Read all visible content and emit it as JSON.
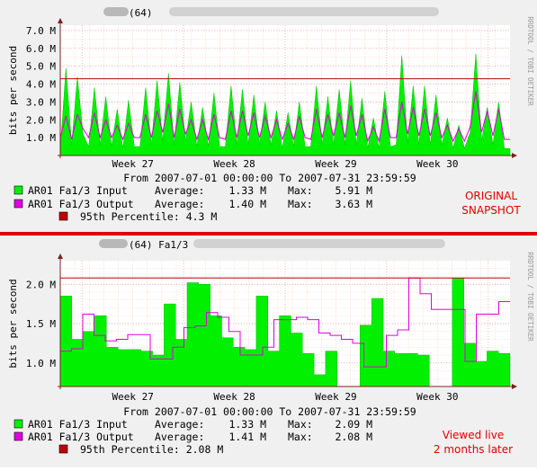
{
  "colors": {
    "input": "#00f000",
    "input_edge": "#00c000",
    "output": "#e000e0",
    "percentile": "#c00000",
    "note": "#e00000",
    "divider": "#e00000"
  },
  "chart_data": [
    {
      "type": "area",
      "title": "(64)",
      "ylabel": "bits per second",
      "ylim": [
        0,
        7.3
      ],
      "y_unit": "M",
      "y_ticks": [
        "1.0 M",
        "2.0 M",
        "3.0 M",
        "4.0 M",
        "5.0 M",
        "6.0 M",
        "7.0 M"
      ],
      "x_ticks": [
        "Week 27",
        "Week 28",
        "Week 29",
        "Week 30"
      ],
      "side_text": "RRDTOOL / TOBI OETIKER",
      "period": "From 2007-07-01 00:00:00 To 2007-07-31 23:59:59",
      "percentile_value": 4.3,
      "series": [
        {
          "name": "AR01 Fa1/3 Input",
          "average": "1.33 M",
          "max": "5.91 M",
          "values": [
            0.3,
            4.9,
            0.6,
            4.4,
            1.2,
            0.5,
            3.8,
            0.6,
            3.3,
            0.5,
            2.6,
            0.4,
            3.1,
            0.5,
            0.5,
            3.8,
            0.6,
            4.2,
            0.8,
            4.6,
            0.6,
            4.1,
            0.8,
            3.0,
            0.5,
            2.7,
            0.5,
            3.5,
            0.5,
            0.5,
            3.9,
            0.6,
            3.7,
            0.6,
            3.4,
            0.6,
            3.0,
            0.6,
            2.5,
            0.4,
            2.4,
            0.5,
            3.0,
            0.5,
            0.5,
            3.9,
            0.6,
            3.3,
            0.6,
            3.7,
            0.6,
            4.2,
            0.6,
            3.2,
            0.4,
            2.1,
            0.4,
            3.6,
            0.5,
            0.6,
            5.6,
            0.7,
            3.9,
            0.6,
            3.9,
            0.6,
            3.4,
            0.6,
            2.1,
            0.4,
            1.7,
            0.4,
            1.3,
            5.7,
            0.8,
            2.7,
            0.6,
            3.0,
            0.4,
            0.4
          ]
        },
        {
          "name": "AR01 Fa1/3 Output",
          "average": "1.40 M",
          "max": "3.63 M",
          "values": [
            1.0,
            2.2,
            0.9,
            2.3,
            1.5,
            1.0,
            2.4,
            1.0,
            2.0,
            1.0,
            1.7,
            0.9,
            1.8,
            1.0,
            1.0,
            2.3,
            1.0,
            2.5,
            1.3,
            2.9,
            1.0,
            2.6,
            1.2,
            2.0,
            0.9,
            2.0,
            0.9,
            2.3,
            1.0,
            0.9,
            2.5,
            1.0,
            2.5,
            1.1,
            2.4,
            1.0,
            2.2,
            1.0,
            2.0,
            0.9,
            1.8,
            0.9,
            2.2,
            1.0,
            0.9,
            2.6,
            1.0,
            2.3,
            1.1,
            2.4,
            1.0,
            2.8,
            1.1,
            2.3,
            0.8,
            1.6,
            0.8,
            2.6,
            1.0,
            1.0,
            3.0,
            1.2,
            2.7,
            1.1,
            2.6,
            1.1,
            2.4,
            1.0,
            1.7,
            0.8,
            1.5,
            0.8,
            1.6,
            3.6,
            1.3,
            2.5,
            1.1,
            2.6,
            0.9,
            0.9
          ]
        }
      ],
      "percentile_label": "95th Percentile: 4.3 M",
      "note": [
        "ORIGINAL",
        "SNAPSHOT"
      ]
    },
    {
      "type": "area",
      "title": "(64) Fa1/3",
      "ylabel": "bits per second",
      "ylim": [
        0.7,
        2.3
      ],
      "y_unit": "M",
      "y_ticks": [
        "1.0 M",
        "1.5 M",
        "2.0 M"
      ],
      "x_ticks": [
        "Week 27",
        "Week 28",
        "Week 29",
        "Week 30"
      ],
      "side_text": "RRDTOOL / TOBI OETIKER",
      "period": "From 2007-07-01 00:00:00 To 2007-07-31 23:59:59",
      "percentile_value": 2.08,
      "series": [
        {
          "name": "AR01 Fa1/3 Input",
          "average": "1.33 M",
          "max": "2.09 M",
          "values": [
            1.85,
            1.3,
            1.4,
            1.6,
            1.2,
            1.17,
            1.17,
            1.15,
            1.1,
            1.75,
            1.3,
            2.02,
            2.0,
            1.6,
            1.32,
            1.2,
            1.17,
            1.85,
            1.15,
            1.6,
            1.38,
            1.12,
            0.85,
            1.15,
            0.7,
            0.7,
            1.48,
            1.82,
            1.15,
            1.12,
            1.12,
            1.1,
            0.7,
            0.7,
            2.08,
            1.25,
            1.02,
            1.15,
            1.12
          ]
        },
        {
          "name": "AR01 Fa1/3 Output",
          "average": "1.41 M",
          "max": "2.08 M",
          "values": [
            1.15,
            1.18,
            1.62,
            1.35,
            1.28,
            1.3,
            1.36,
            1.36,
            1.05,
            1.05,
            1.2,
            1.45,
            1.47,
            1.64,
            1.58,
            1.4,
            1.1,
            1.1,
            1.2,
            1.55,
            1.55,
            1.58,
            1.55,
            1.38,
            1.35,
            1.3,
            1.25,
            0.95,
            0.95,
            1.35,
            1.42,
            2.08,
            1.88,
            1.68,
            1.68,
            1.68,
            1.02,
            1.62,
            1.62,
            1.78
          ]
        }
      ],
      "percentile_label": "95th Percentile: 2.08 M",
      "note": [
        "Viewed live",
        "2 months later"
      ]
    }
  ]
}
